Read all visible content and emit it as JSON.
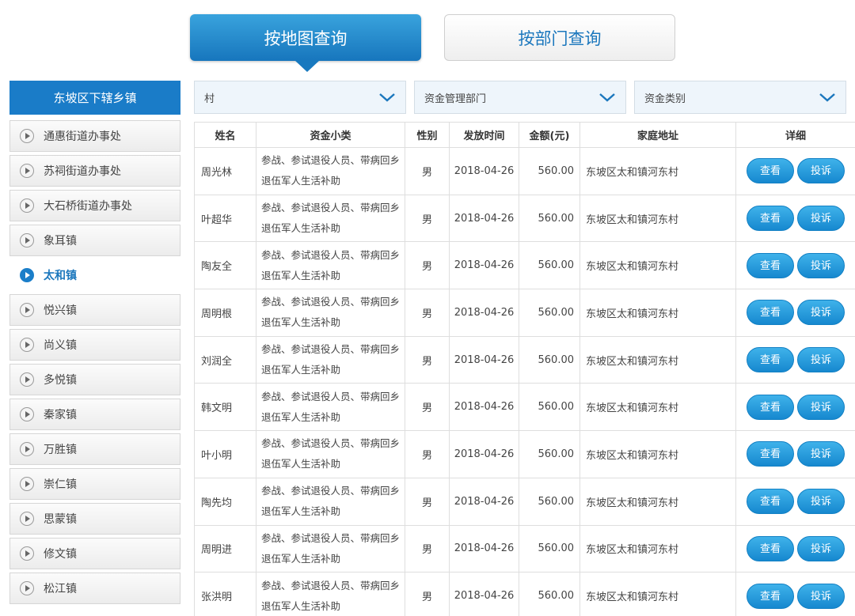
{
  "tabs": {
    "map": "按地图查询",
    "dept": "按部门查询"
  },
  "sidebar": {
    "header": "东坡区下辖乡镇",
    "items": [
      {
        "label": "通惠街道办事处",
        "active": false
      },
      {
        "label": "苏祠街道办事处",
        "active": false
      },
      {
        "label": "大石桥街道办事处",
        "active": false
      },
      {
        "label": "象耳镇",
        "active": false
      },
      {
        "label": "太和镇",
        "active": true
      },
      {
        "label": "悦兴镇",
        "active": false
      },
      {
        "label": "尚义镇",
        "active": false
      },
      {
        "label": "多悦镇",
        "active": false
      },
      {
        "label": "秦家镇",
        "active": false
      },
      {
        "label": "万胜镇",
        "active": false
      },
      {
        "label": "崇仁镇",
        "active": false
      },
      {
        "label": "思蒙镇",
        "active": false
      },
      {
        "label": "修文镇",
        "active": false
      },
      {
        "label": "松江镇",
        "active": false
      }
    ]
  },
  "filters": {
    "village": "村",
    "dept": "资金管理部门",
    "type": "资金类别"
  },
  "table": {
    "headers": [
      "姓名",
      "资金小类",
      "性别",
      "发放时间",
      "金额(元)",
      "家庭地址",
      "详细"
    ],
    "view_label": "查看",
    "complain_label": "投诉",
    "rows": [
      {
        "name": "周光林",
        "category": "参战、参试退役人员、带病回乡退伍军人生活补助",
        "sex": "男",
        "date": "2018-04-26",
        "amount": "560.00",
        "address": "东坡区太和镇河东村"
      },
      {
        "name": "叶超华",
        "category": "参战、参试退役人员、带病回乡退伍军人生活补助",
        "sex": "男",
        "date": "2018-04-26",
        "amount": "560.00",
        "address": "东坡区太和镇河东村"
      },
      {
        "name": "陶友全",
        "category": "参战、参试退役人员、带病回乡退伍军人生活补助",
        "sex": "男",
        "date": "2018-04-26",
        "amount": "560.00",
        "address": "东坡区太和镇河东村"
      },
      {
        "name": "周明根",
        "category": "参战、参试退役人员、带病回乡退伍军人生活补助",
        "sex": "男",
        "date": "2018-04-26",
        "amount": "560.00",
        "address": "东坡区太和镇河东村"
      },
      {
        "name": "刘润全",
        "category": "参战、参试退役人员、带病回乡退伍军人生活补助",
        "sex": "男",
        "date": "2018-04-26",
        "amount": "560.00",
        "address": "东坡区太和镇河东村"
      },
      {
        "name": "韩文明",
        "category": "参战、参试退役人员、带病回乡退伍军人生活补助",
        "sex": "男",
        "date": "2018-04-26",
        "amount": "560.00",
        "address": "东坡区太和镇河东村"
      },
      {
        "name": "叶小明",
        "category": "参战、参试退役人员、带病回乡退伍军人生活补助",
        "sex": "男",
        "date": "2018-04-26",
        "amount": "560.00",
        "address": "东坡区太和镇河东村"
      },
      {
        "name": "陶先均",
        "category": "参战、参试退役人员、带病回乡退伍军人生活补助",
        "sex": "男",
        "date": "2018-04-26",
        "amount": "560.00",
        "address": "东坡区太和镇河东村"
      },
      {
        "name": "周明进",
        "category": "参战、参试退役人员、带病回乡退伍军人生活补助",
        "sex": "男",
        "date": "2018-04-26",
        "amount": "560.00",
        "address": "东坡区太和镇河东村"
      },
      {
        "name": "张洪明",
        "category": "参战、参试退役人员、带病回乡退伍军人生活补助",
        "sex": "男",
        "date": "2018-04-26",
        "amount": "560.00",
        "address": "东坡区太和镇河东村"
      }
    ]
  },
  "colors": {
    "primary": "#1a7cc8",
    "button": "#1688cf",
    "filter_bg": "#eef5fb"
  }
}
